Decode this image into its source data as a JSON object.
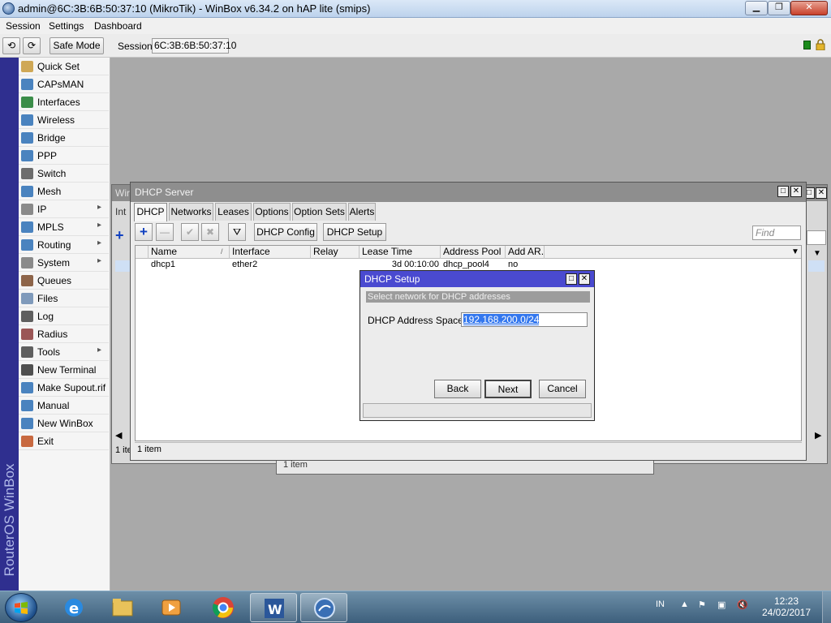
{
  "window": {
    "title": "admin@6C:3B:6B:50:37:10 (MikroTik) - WinBox v6.34.2 on hAP lite (smips)"
  },
  "menu": [
    "Session",
    "Settings",
    "Dashboard"
  ],
  "toolbar": {
    "safe_mode": "Safe Mode",
    "session_label": "Session:",
    "session_value": "6C:3B:6B:50:37:10"
  },
  "brand": "RouterOS WinBox",
  "sidebar": [
    {
      "label": "Quick Set",
      "icon": "quick-set-icon"
    },
    {
      "label": "CAPsMAN",
      "icon": "capsman-icon"
    },
    {
      "label": "Interfaces",
      "icon": "interfaces-icon"
    },
    {
      "label": "Wireless",
      "icon": "wireless-icon"
    },
    {
      "label": "Bridge",
      "icon": "bridge-icon"
    },
    {
      "label": "PPP",
      "icon": "ppp-icon"
    },
    {
      "label": "Switch",
      "icon": "switch-icon"
    },
    {
      "label": "Mesh",
      "icon": "mesh-icon"
    },
    {
      "label": "IP",
      "icon": "ip-icon",
      "submenu": true
    },
    {
      "label": "MPLS",
      "icon": "mpls-icon",
      "submenu": true
    },
    {
      "label": "Routing",
      "icon": "routing-icon",
      "submenu": true
    },
    {
      "label": "System",
      "icon": "system-icon",
      "submenu": true
    },
    {
      "label": "Queues",
      "icon": "queues-icon"
    },
    {
      "label": "Files",
      "icon": "files-icon"
    },
    {
      "label": "Log",
      "icon": "log-icon"
    },
    {
      "label": "Radius",
      "icon": "radius-icon"
    },
    {
      "label": "Tools",
      "icon": "tools-icon",
      "submenu": true
    },
    {
      "label": "New Terminal",
      "icon": "terminal-icon"
    },
    {
      "label": "Make Supout.rif",
      "icon": "supout-icon"
    },
    {
      "label": "Manual",
      "icon": "manual-icon"
    },
    {
      "label": "New WinBox",
      "icon": "winbox-icon"
    },
    {
      "label": "Exit",
      "icon": "exit-icon"
    }
  ],
  "bg_window": {
    "title": "Wir",
    "tab": "Int",
    "status": "1 ite",
    "lower_status": "1 item"
  },
  "dhcp_server": {
    "title": "DHCP Server",
    "tabs": [
      "DHCP",
      "Networks",
      "Leases",
      "Options",
      "Option Sets",
      "Alerts"
    ],
    "active_tab": "DHCP",
    "buttons": {
      "config": "DHCP Config",
      "setup": "DHCP Setup"
    },
    "find_placeholder": "Find",
    "columns": [
      "Name",
      "Interface",
      "Relay",
      "Lease Time",
      "Address Pool",
      "Add AR..."
    ],
    "rows": [
      {
        "name": "dhcp1",
        "interface": "ether2",
        "relay": "",
        "lease_time": "3d 00:10:00",
        "address_pool": "dhcp_pool4",
        "add_arp": "no"
      }
    ],
    "status": "1 item"
  },
  "dhcp_setup": {
    "title": "DHCP Setup",
    "hint": "Select network for DHCP addresses",
    "field_label": "DHCP Address Space:",
    "field_value": "192.168.200.0/24",
    "back": "Back",
    "next": "Next",
    "cancel": "Cancel"
  },
  "taskbar": {
    "apps": [
      "internet-explorer-icon",
      "file-explorer-icon",
      "media-player-icon",
      "chrome-icon",
      "word-icon",
      "winbox-app-icon"
    ],
    "lang": "IN",
    "time": "12:23",
    "date": "24/02/2017"
  }
}
